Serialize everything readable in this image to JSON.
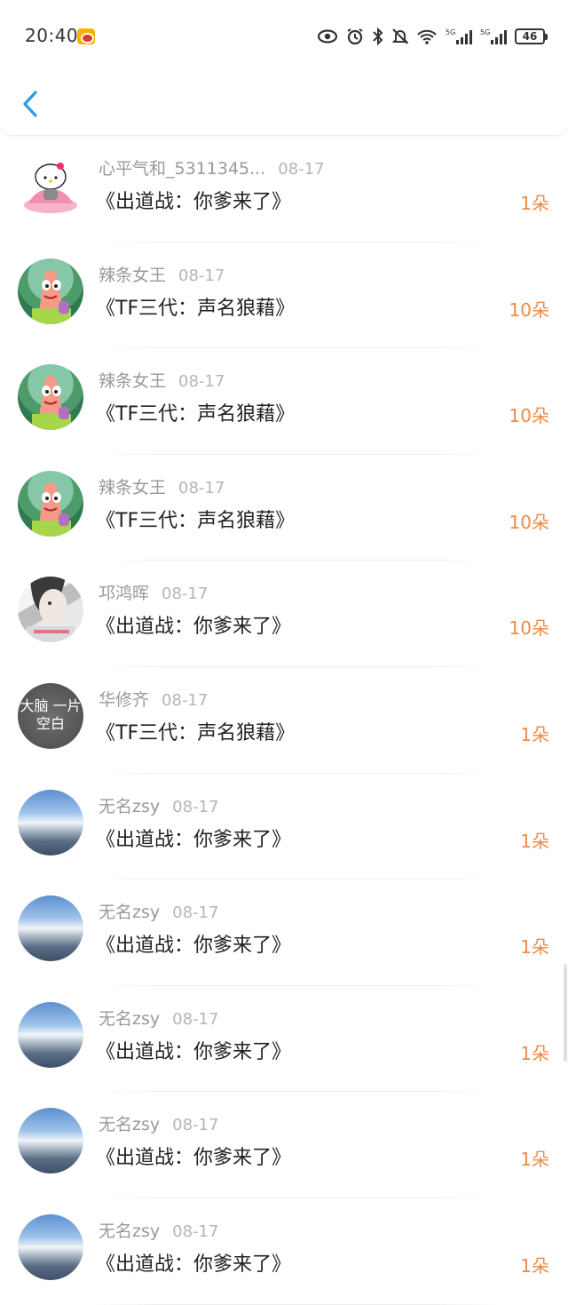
{
  "status_bar": {
    "time": "20:40",
    "battery": "46",
    "icons": [
      "weibo-icon",
      "eye-icon",
      "alarm-icon",
      "bluetooth-icon",
      "mute-icon",
      "wifi-icon",
      "signal-5g-icon",
      "signal-5g-icon",
      "battery-icon"
    ]
  },
  "header": {
    "back_icon": "chevron-left-icon",
    "accent": "#2a9be0"
  },
  "colors": {
    "count": "#ef8a45",
    "name": "#999999",
    "title": "#222222"
  },
  "rows": [
    {
      "name": "心平气和_5311345...",
      "date": "08-17",
      "title": "《出道战：你爹来了》",
      "count": "1朵",
      "avatar": "kitty"
    },
    {
      "name": "辣条女王",
      "date": "08-17",
      "title": "《TF三代：声名狼藉》",
      "count": "10朵",
      "avatar": "patrick"
    },
    {
      "name": "辣条女王",
      "date": "08-17",
      "title": "《TF三代：声名狼藉》",
      "count": "10朵",
      "avatar": "patrick"
    },
    {
      "name": "辣条女王",
      "date": "08-17",
      "title": "《TF三代：声名狼藉》",
      "count": "10朵",
      "avatar": "patrick"
    },
    {
      "name": "邛鸿晖",
      "date": "08-17",
      "title": "《出道战：你爹来了》",
      "count": "10朵",
      "avatar": "girl"
    },
    {
      "name": "华修齐",
      "date": "08-17",
      "title": "《TF三代：声名狼藉》",
      "count": "1朵",
      "avatar": "gray",
      "avatar_text": "大脑 一片空白"
    },
    {
      "name": "无名zsy",
      "date": "08-17",
      "title": "《出道战：你爹来了》",
      "count": "1朵",
      "avatar": "sky"
    },
    {
      "name": "无名zsy",
      "date": "08-17",
      "title": "《出道战：你爹来了》",
      "count": "1朵",
      "avatar": "sky"
    },
    {
      "name": "无名zsy",
      "date": "08-17",
      "title": "《出道战：你爹来了》",
      "count": "1朵",
      "avatar": "sky"
    },
    {
      "name": "无名zsy",
      "date": "08-17",
      "title": "《出道战：你爹来了》",
      "count": "1朵",
      "avatar": "sky"
    },
    {
      "name": "无名zsy",
      "date": "08-17",
      "title": "《出道战：你爹来了》",
      "count": "1朵",
      "avatar": "sky"
    }
  ]
}
